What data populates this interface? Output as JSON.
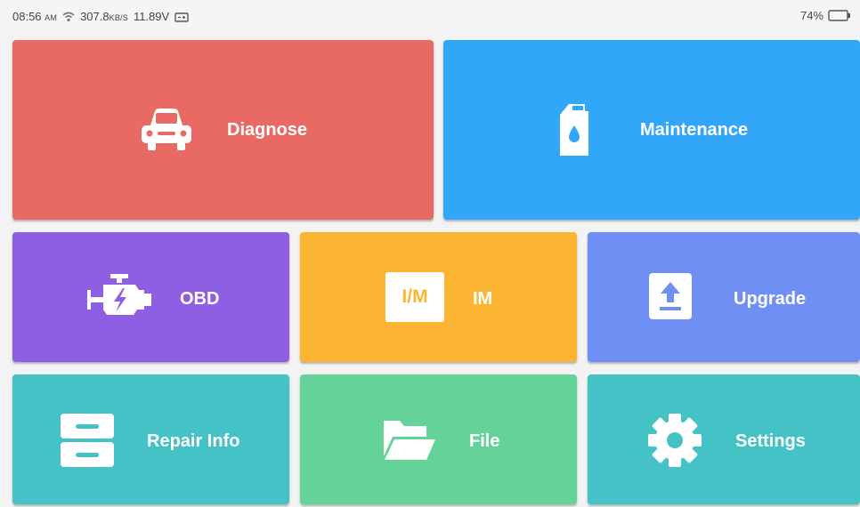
{
  "status_bar": {
    "time": "08:56",
    "ampm": "AM",
    "network_speed_value": "307.8",
    "network_speed_unit": "KB/S",
    "voltage": "11.89V",
    "battery_percent": "74%"
  },
  "colors": {
    "diagnose": "#e96a64",
    "maintenance": "#32a6f9",
    "obd": "#8e5ee3",
    "im": "#fbb532",
    "upgrade": "#6f8ff5",
    "repair_info": "#44c2c6",
    "file": "#65d29a",
    "settings": "#44c2c6"
  },
  "tiles": {
    "diagnose": {
      "label": "Diagnose",
      "icon": "car-icon"
    },
    "maintenance": {
      "label": "Maintenance",
      "icon": "oil-can-icon"
    },
    "obd": {
      "label": "OBD",
      "icon": "engine-icon"
    },
    "im": {
      "label": "IM",
      "icon": "im-icon",
      "icon_text": "I/M"
    },
    "upgrade": {
      "label": "Upgrade",
      "icon": "upload-icon"
    },
    "repair_info": {
      "label": "Repair Info",
      "icon": "database-icon"
    },
    "file": {
      "label": "File",
      "icon": "folder-icon"
    },
    "settings": {
      "label": "Settings",
      "icon": "gear-icon"
    }
  }
}
